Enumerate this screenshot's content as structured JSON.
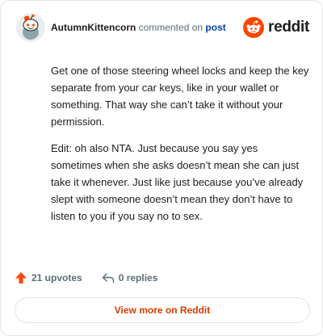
{
  "header": {
    "username": "AutumnKittencorn",
    "action_text": "commented on",
    "target_link": "post",
    "brand_name": "reddit"
  },
  "comment": {
    "paragraphs": [
      "Get one of those steering wheel locks and keep the key separate from your car keys, like in your wallet or something. That way she can’t take it without your permission.",
      "Edit: oh also NTA. Just because you say yes sometimes when she asks doesn’t mean she can just take it whenever. Just like just because you’ve already slept with someone doesn’t mean they don’t have to listen to you if you say no to sex."
    ]
  },
  "footer": {
    "upvotes": "21 upvotes",
    "replies": "0 replies"
  },
  "view_more_label": "View more on Reddit",
  "colors": {
    "accent": "#ff4500",
    "link": "#0045ac",
    "muted": "#576f76",
    "view_more": "#d93a00"
  },
  "icons": {
    "avatar": "snoo-avatar-icon",
    "brand": "reddit-logo-icon",
    "upvote": "upvote-arrow-icon",
    "reply": "reply-arrow-icon"
  }
}
